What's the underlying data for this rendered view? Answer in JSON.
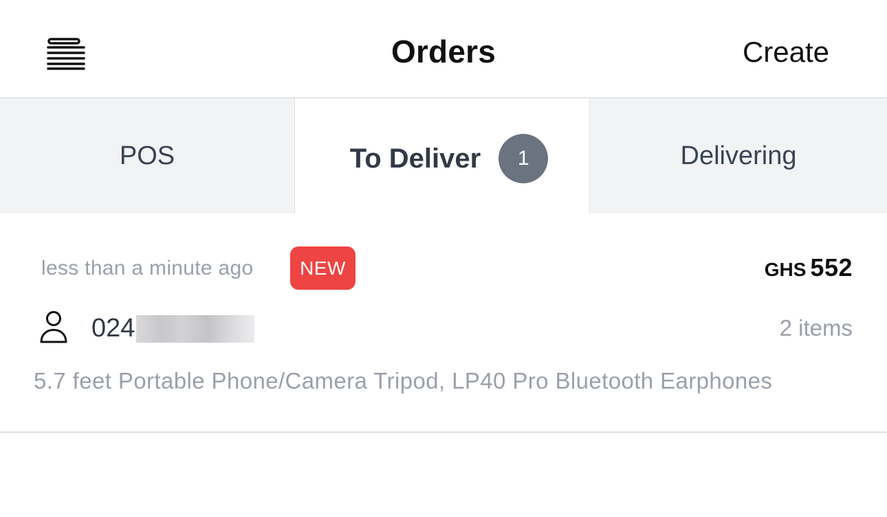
{
  "header": {
    "menu_icon": "hamburger-menu-icon",
    "title": "Orders",
    "create_label": "Create"
  },
  "tabs": [
    {
      "label": "POS",
      "active": false
    },
    {
      "label": "To Deliver",
      "active": true,
      "badge": "1"
    },
    {
      "label": "Delivering",
      "active": false
    }
  ],
  "orders": [
    {
      "time": "less than a minute ago",
      "status_badge": "NEW",
      "currency": "GHS",
      "amount": "552",
      "customer_icon": "person-icon",
      "customer_phone": "024",
      "customer_phone_redacted": true,
      "item_count": "2 items",
      "item_names": "5.7 feet Portable Phone/Camera Tripod, LP40 Pro Bluetooth Earphones"
    }
  ],
  "colors": {
    "new_badge": "#ee4444",
    "tab_badge": "#6b7380",
    "tab_inactive_bg": "#f2f3f5",
    "muted_text": "#9aa0aa"
  }
}
